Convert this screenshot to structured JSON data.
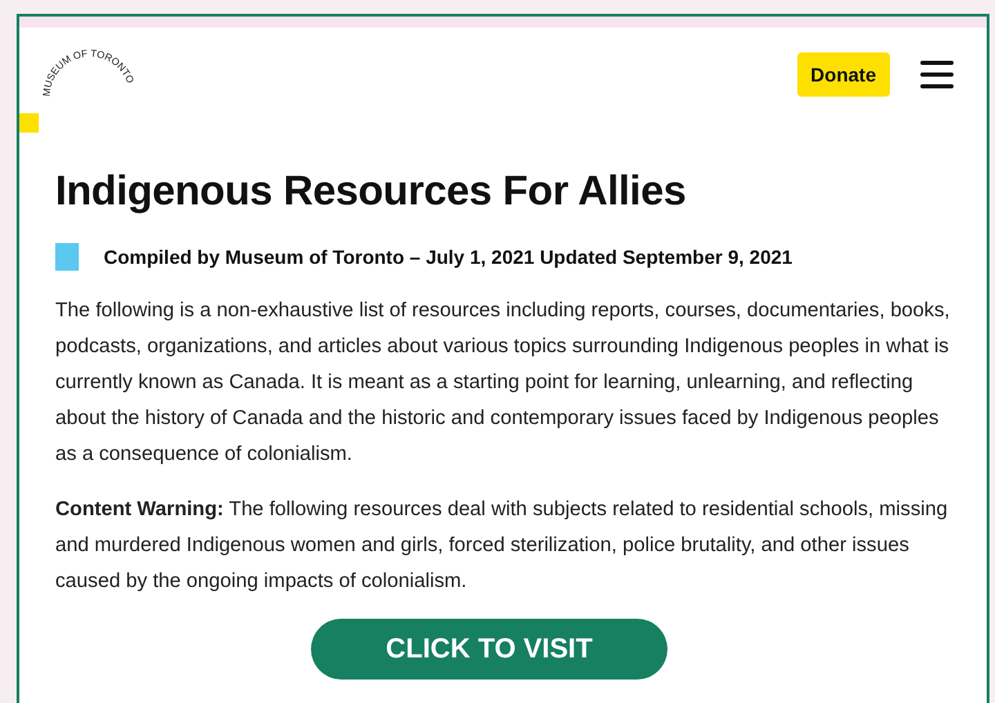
{
  "header": {
    "logo": "MUSEUM OF TORONTO",
    "donate": "Donate"
  },
  "article": {
    "title": "Indigenous Resources For Allies",
    "byline": "Compiled by Museum of Toronto – July 1, 2021 Updated September 9, 2021",
    "intro": "The following is a non-exhaustive list of resources including reports, courses, documentaries, books, podcasts, organizations, and articles about various topics surrounding Indigenous peoples in what is currently known as Canada. It is meant as a starting point for learning, unlearning, and reflecting about the history of Canada and the historic and contemporary issues faced by Indigenous peoples as a consequence of colonialism.",
    "warning": "**Content Warning:** The following resources deal with subjects related to residential schools, missing and murdered Indigenous women and girls, forced sterilization, police brutality, and other issues caused by the ongoing impacts of colonialism.",
    "cta": "CLICK TO VISIT"
  }
}
